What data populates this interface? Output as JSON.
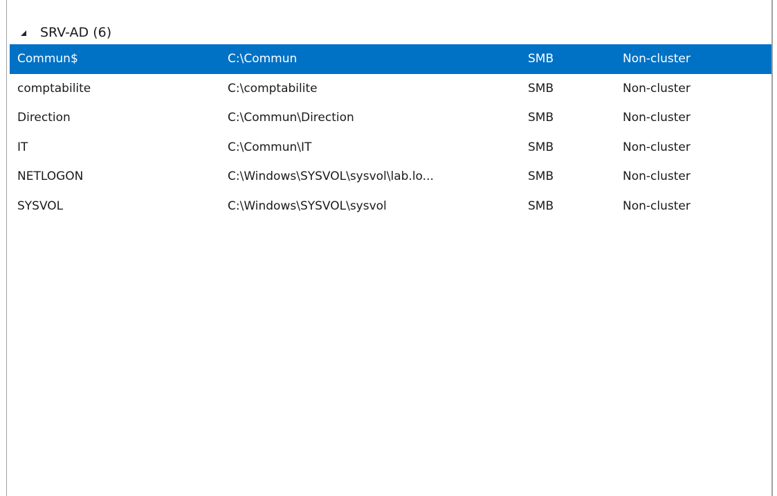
{
  "group": {
    "label": "SRV-AD (6)"
  },
  "shares": [
    {
      "name": "Commun$",
      "path": "C:\\Commun",
      "protocol": "SMB",
      "availability": "Non-cluster",
      "selected": true
    },
    {
      "name": "comptabilite",
      "path": "C:\\comptabilite",
      "protocol": "SMB",
      "availability": "Non-cluster",
      "selected": false
    },
    {
      "name": "Direction",
      "path": "C:\\Commun\\Direction",
      "protocol": "SMB",
      "availability": "Non-cluster",
      "selected": false
    },
    {
      "name": "IT",
      "path": "C:\\Commun\\IT",
      "protocol": "SMB",
      "availability": "Non-cluster",
      "selected": false
    },
    {
      "name": "NETLOGON",
      "path": "C:\\Windows\\SYSVOL\\sysvol\\lab.lo...",
      "protocol": "SMB",
      "availability": "Non-cluster",
      "selected": false
    },
    {
      "name": "SYSVOL",
      "path": "C:\\Windows\\SYSVOL\\sysvol",
      "protocol": "SMB",
      "availability": "Non-cluster",
      "selected": false
    }
  ],
  "colors": {
    "selection": "#0072c6",
    "selection_text": "#ffffff",
    "text": "#1a1a1a"
  }
}
